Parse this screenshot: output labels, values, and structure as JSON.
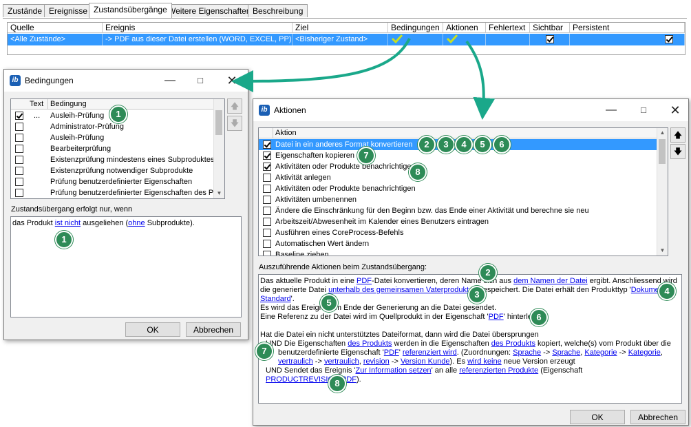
{
  "tabs": [
    {
      "label": "Zustände"
    },
    {
      "label": "Ereignisse"
    },
    {
      "label": "Zustandsübergänge"
    },
    {
      "label": "Weitere Eigenschaften"
    },
    {
      "label": "Beschreibung"
    }
  ],
  "grid": {
    "headers": [
      "Quelle",
      "Ereignis",
      "Ziel",
      "Bedingungen",
      "Aktionen",
      "Fehlertext",
      "Sichtbar",
      "Persistent"
    ],
    "row": {
      "quelle": "<Alle Zustände>",
      "ereignis": "-> PDF aus dieser Datei erstellen (WORD, EXCEL, PP)",
      "ziel": "<Bisheriger Zustand>",
      "sichtbar": true,
      "persistent": true
    }
  },
  "colors": {
    "selection": "#3399ff",
    "badge": "#2e8b57",
    "arrow": "#1aa88a",
    "link": "#0000ee"
  },
  "bedingungen": {
    "title": "Bedingungen",
    "col_text": "Text",
    "col_bedingung": "Bedingung",
    "items": [
      {
        "checked": true,
        "text": "...",
        "label": "Ausleih-Prüfung"
      },
      {
        "checked": false,
        "text": "",
        "label": "Administrator-Prüfung"
      },
      {
        "checked": false,
        "text": "",
        "label": "Ausleih-Prüfung"
      },
      {
        "checked": false,
        "text": "",
        "label": "Bearbeiterprüfung"
      },
      {
        "checked": false,
        "text": "",
        "label": "Existenzprüfung mindestens eines Subproduktes"
      },
      {
        "checked": false,
        "text": "",
        "label": "Existenzprüfung notwendiger Subprodukte"
      },
      {
        "checked": false,
        "text": "",
        "label": "Prüfung benutzerdefinierter Eigenschaften"
      },
      {
        "checked": false,
        "text": "",
        "label": "Prüfung benutzerdefinierter Eigenschaften des Pr"
      }
    ],
    "desc_label": "Zustandsübergang erfolgt nur, wenn",
    "desc": {
      "p1": "das Produkt ",
      "l1": "ist nicht",
      "p2": " ausgeliehen (",
      "l2": "ohne",
      "p3": " Subprodukte)."
    },
    "ok": "OK",
    "cancel": "Abbrechen"
  },
  "aktionen": {
    "title": "Aktionen",
    "col_aktion": "Aktion",
    "items": [
      {
        "checked": true,
        "label": "Datei in ein anderes Format konvertieren",
        "selected": true
      },
      {
        "checked": true,
        "label": "Eigenschaften kopieren"
      },
      {
        "checked": true,
        "label": "Aktivitäten oder Produkte benachrichtigen"
      },
      {
        "checked": false,
        "label": "Aktivität anlegen"
      },
      {
        "checked": false,
        "label": "Aktivitäten oder Produkte benachrichtigen"
      },
      {
        "checked": false,
        "label": "Aktivitäten umbenennen"
      },
      {
        "checked": false,
        "label": "Ändere die Einschränkung für den Beginn bzw. das Ende einer Aktivität und berechne sie neu"
      },
      {
        "checked": false,
        "label": "Arbeitszeit/Abwesenheit im Kalender eines Benutzers eintragen"
      },
      {
        "checked": false,
        "label": "Ausführen eines CoreProcess-Befehls"
      },
      {
        "checked": false,
        "label": "Automatischen Wert ändern"
      },
      {
        "checked": false,
        "label": "Baseline ziehen"
      }
    ],
    "desc_label": "Auszuführende Aktionen beim Zustandsübergang:",
    "d": {
      "a1": "Das aktuelle Produkt in eine ",
      "a2": "PDF",
      "a3": "-Datei konvertieren, deren Name sich aus ",
      "a4": "dem Namen der Datei",
      "a5": " ergibt. Anschliessend wird",
      "b1": "die generierte Datei ",
      "b2": "unterhalb des gemeinsamen Vaterproduktes",
      "b3": " gespeichert. Die Datei erhält den Produkttyp '",
      "b4": "Dokument -",
      "c1": "Standard",
      "c2": "'.",
      "e1": "Es wird das Ereignis am Ende der Generierung an die Datei gesendet.",
      "f1": "Eine Referenz zu der Datei wird im Quellprodukt in der Eigenschaft '",
      "f2": "PDF",
      "f3": "' hinterlegt.",
      "g1": "Hat die Datei ein nicht unterstütztes Dateiformat, dann wird die Datei übersprungen",
      "h1": "UND Die Eigenschaften ",
      "h2": "des Produkts",
      "h3": " werden in die Eigenschaften ",
      "h4": "des Produkts",
      "h5": " kopiert, welche(s) vom Produkt über die",
      "i1": "benutzerdefinierte Eigenschaft '",
      "i2": "PDF",
      "i3": "' ",
      "i4": "referenziert wird",
      "i5": ". (Zuordnungen: ",
      "i6": "Sprache",
      "i7": " -> ",
      "i8": "Sprache",
      "i9": ", ",
      "i10": "Kategorie",
      "i11": " -> ",
      "i12": "Kategorie",
      "i13": ",",
      "j1": "vertraulich",
      "j2": " -> ",
      "j3": "vertraulich",
      "j4": ", ",
      "j5": "revision",
      "j6": " -> ",
      "j7": "Version Kunde",
      "j8": "). Es ",
      "j9": "wird keine",
      "j10": " neue Version erzeugt",
      "k1": "UND Sendet das Ereignis '",
      "k2": "Zur Information setzen",
      "k3": "' an alle ",
      "k4": "referenzierten Produkte",
      "k5": " (Eigenschaft ",
      "k6": "PRODUCTREVISION.PDF",
      "k7": ")."
    },
    "ok": "OK",
    "cancel": "Abbrechen"
  },
  "badges": [
    "1",
    "2",
    "3",
    "4",
    "5",
    "6",
    "7",
    "8"
  ]
}
